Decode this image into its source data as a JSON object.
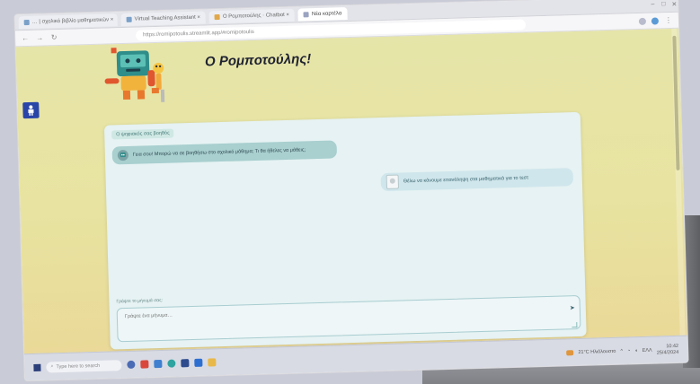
{
  "browser": {
    "tabs": [
      {
        "label": "… | σχολικό βιβλίο μαθηματικών ×",
        "active": false
      },
      {
        "label": "Virtual Teaching Assistant ×",
        "active": false
      },
      {
        "label": "Ο Ρομποτούλης · Chatbot ×",
        "active": false
      },
      {
        "label": "Νέα καρτέλα",
        "active": true
      }
    ],
    "url": "https://romipotoulis.streamlit.app/#romipotoulis"
  },
  "page": {
    "title": "Ο Ρομποτούλης!",
    "side_button_icon": "person-icon"
  },
  "chat": {
    "heading": "Ο ψηφιακός σας βοηθός",
    "bot_message": "Γεια σου! Μπορώ να σε βοηθήσω στο σχολικό μάθημα; Τι θα ήθελες να μάθεις;",
    "user_message": "Θέλω να κάνουμε επανάληψη στα μαθηματικά για το τεστ",
    "input_label": "Γράψτε το μήνυμά σας:",
    "input_placeholder": "Γράψτε ένα μήνυμα…",
    "send_icon": "send-icon"
  },
  "taskbar": {
    "search_placeholder": "Type here to search",
    "tray_text": "21°C Ηλιόλουστο",
    "language": "ΕΛΛ",
    "time": "10:42",
    "date": "25/4/2024"
  },
  "colors": {
    "page_gradient_top": "#e6e5a9",
    "page_gradient_bottom": "#ead998",
    "chat_bg": "#e6f2f3",
    "bot_bubble": "#a9cfcf",
    "user_bubble": "#cfe6ec",
    "accent_blue": "#2a45a8"
  }
}
